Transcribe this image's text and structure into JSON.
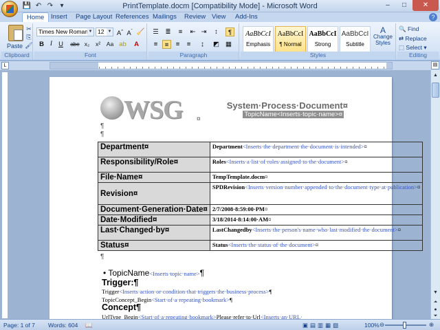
{
  "window": {
    "title": "PrintTemplate.docm [Compatibility Mode] - Microsoft Word",
    "minimize": "–",
    "maximize": "□",
    "close": "✕"
  },
  "qat": {
    "save": "💾",
    "undo": "↶",
    "redo": "↷",
    "more": "▾"
  },
  "tabs": [
    "Home",
    "Insert",
    "Page Layout",
    "References",
    "Mailings",
    "Review",
    "View",
    "Add-Ins"
  ],
  "help": "?",
  "ribbon": {
    "clipboard": {
      "label": "Clipboard",
      "paste": "Paste"
    },
    "font": {
      "label": "Font",
      "font_name": "Times New Roman",
      "font_size": "12",
      "buttons": [
        "B",
        "I",
        "U",
        "abe",
        "x₂",
        "x²",
        "Aa"
      ]
    },
    "paragraph": {
      "label": "Paragraph"
    },
    "styles": {
      "label": "Styles",
      "items": [
        {
          "preview": "AaBbCcI",
          "name": "Emphasis"
        },
        {
          "preview": "AaBbCcI",
          "name": "¶ Normal"
        },
        {
          "preview": "AaBbCcI",
          "name": "Strong"
        },
        {
          "preview": "AaBbCcI",
          "name": "Subtitle"
        }
      ],
      "change": "Change Styles"
    },
    "editing": {
      "label": "Editing",
      "find": "Find",
      "replace": "Replace",
      "select": "Select"
    }
  },
  "document": {
    "logo": "WSG",
    "title": "System·Process·Document¤",
    "subtitle": "TopicName<Inserts·topic·name>¤",
    "rows": [
      {
        "label": "Department¤",
        "field": "Department",
        "hint": "<Inserts·the·department·the·document·is·intended>",
        "end": "¤"
      },
      {
        "label": "Responsibility/Role¤",
        "field": "Roles",
        "hint": "<Inserts·a·list·of·roles·assigned·to·the·document>",
        "end": "¤"
      },
      {
        "label": "File·Name¤",
        "field": "TempTemplate.docm",
        "hint": "",
        "end": "¤"
      },
      {
        "label": "Revision¤",
        "field": "SPDRevision",
        "hint": "<Inserts·version·number·appended·to·the·document·type·at·publication>",
        "end": "¤"
      },
      {
        "label": "Document·Generation·Date¤",
        "field": "2/7/2008·8:59:00·PM",
        "hint": "",
        "end": "¤"
      },
      {
        "label": "Date·Modified¤",
        "field": "3/18/2014·8:14:00·AM",
        "hint": "",
        "end": "¤"
      },
      {
        "label": "Last·Changed·by¤",
        "field": "LastChangedby",
        "hint": "<Inserts·the·person's·name·who·last·modified·the·document>",
        "end": "¤"
      },
      {
        "label": "Status¤",
        "field": "Status",
        "hint": "<Inserts·the·status·of·the·document>",
        "end": "¤"
      }
    ],
    "topic_name": "TopicName",
    "topic_hint": "<Inserts·topic·name>",
    "trigger_heading": "Trigger:¶",
    "trigger_field": "Trigger",
    "trigger_hint": "<Inserts·action·or·condition·that·triggers·the·business·process>",
    "concept_begin": "TopicConcept_Begin",
    "concept_begin_hint": "<Start·of·a·repeating·bookmark>",
    "concept_heading": "Concept¶",
    "urltype_begin": "UrlType_Begin",
    "urltype_hint": "<Start·of·a·repeating·bookmark>",
    "please_refer": "Please·refer·to·",
    "url_field": "Url",
    "url_hint": "<Inserts·an·URL·"
  },
  "status": {
    "page": "Page: 1 of 7",
    "words": "Words: 604",
    "zoom": "100%"
  }
}
